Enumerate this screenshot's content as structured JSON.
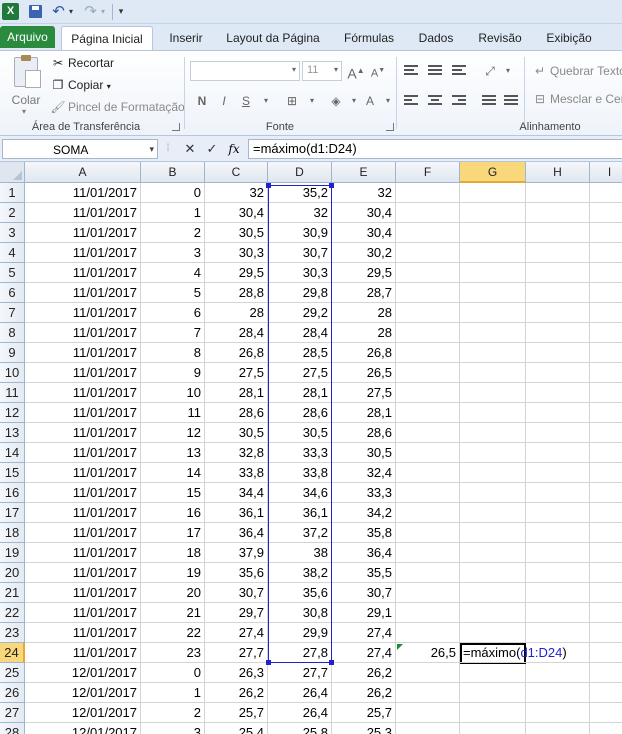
{
  "qat": {
    "undo": "↶",
    "redo": "↷",
    "excel": "X"
  },
  "tabs": [
    "Arquivo",
    "Página Inicial",
    "Inserir",
    "Layout da Página",
    "Fórmulas",
    "Dados",
    "Revisão",
    "Exibição"
  ],
  "ribbon": {
    "clipboard": {
      "paste": "Colar",
      "cut": "Recortar",
      "copy": "Copiar",
      "painter": "Pincel de Formatação",
      "label": "Área de Transferência"
    },
    "font": {
      "name": "",
      "size": "11",
      "bold": "N",
      "italic": "I",
      "underline": "S",
      "label": "Fonte"
    },
    "alignment": {
      "wrap": "Quebrar Texto",
      "merge": "Mesclar e Cen",
      "label": "Alinhamento"
    }
  },
  "formula_bar": {
    "name_box": "SOMA",
    "formula": "=máximo(d1:D24)",
    "fx": "fx"
  },
  "columns": [
    "A",
    "B",
    "C",
    "D",
    "E",
    "F",
    "G",
    "H",
    "I"
  ],
  "rows": [
    [
      "1",
      "11/01/2017",
      "0",
      "32",
      "35,2",
      "32"
    ],
    [
      "2",
      "11/01/2017",
      "1",
      "30,4",
      "32",
      "30,4"
    ],
    [
      "3",
      "11/01/2017",
      "2",
      "30,5",
      "30,9",
      "30,4"
    ],
    [
      "4",
      "11/01/2017",
      "3",
      "30,3",
      "30,7",
      "30,2"
    ],
    [
      "5",
      "11/01/2017",
      "4",
      "29,5",
      "30,3",
      "29,5"
    ],
    [
      "6",
      "11/01/2017",
      "5",
      "28,8",
      "29,8",
      "28,7"
    ],
    [
      "7",
      "11/01/2017",
      "6",
      "28",
      "29,2",
      "28"
    ],
    [
      "8",
      "11/01/2017",
      "7",
      "28,4",
      "28,4",
      "28"
    ],
    [
      "9",
      "11/01/2017",
      "8",
      "26,8",
      "28,5",
      "26,8"
    ],
    [
      "10",
      "11/01/2017",
      "9",
      "27,5",
      "27,5",
      "26,5"
    ],
    [
      "11",
      "11/01/2017",
      "10",
      "28,1",
      "28,1",
      "27,5"
    ],
    [
      "12",
      "11/01/2017",
      "11",
      "28,6",
      "28,6",
      "28,1"
    ],
    [
      "13",
      "11/01/2017",
      "12",
      "30,5",
      "30,5",
      "28,6"
    ],
    [
      "14",
      "11/01/2017",
      "13",
      "32,8",
      "33,3",
      "30,5"
    ],
    [
      "15",
      "11/01/2017",
      "14",
      "33,8",
      "33,8",
      "32,4"
    ],
    [
      "16",
      "11/01/2017",
      "15",
      "34,4",
      "34,6",
      "33,3"
    ],
    [
      "17",
      "11/01/2017",
      "16",
      "36,1",
      "36,1",
      "34,2"
    ],
    [
      "18",
      "11/01/2017",
      "17",
      "36,4",
      "37,2",
      "35,8"
    ],
    [
      "19",
      "11/01/2017",
      "18",
      "37,9",
      "38",
      "36,4"
    ],
    [
      "20",
      "11/01/2017",
      "19",
      "35,6",
      "38,2",
      "35,5"
    ],
    [
      "21",
      "11/01/2017",
      "20",
      "30,7",
      "35,6",
      "30,7"
    ],
    [
      "22",
      "11/01/2017",
      "21",
      "29,7",
      "30,8",
      "29,1"
    ],
    [
      "23",
      "11/01/2017",
      "22",
      "27,4",
      "29,9",
      "27,4"
    ],
    [
      "24",
      "11/01/2017",
      "23",
      "27,7",
      "27,8",
      "27,4"
    ],
    [
      "25",
      "12/01/2017",
      "0",
      "26,3",
      "27,7",
      "26,2"
    ],
    [
      "26",
      "12/01/2017",
      "1",
      "26,2",
      "26,4",
      "26,2"
    ],
    [
      "27",
      "12/01/2017",
      "2",
      "25,7",
      "26,4",
      "25,7"
    ],
    [
      "28",
      "12/01/2017",
      "3",
      "25,4",
      "25,8",
      "25,3"
    ]
  ],
  "cell_f24": "26,5",
  "edit_cell": {
    "prefix": "=máximo(",
    "ref": "d1:D24",
    "suffix": ")"
  }
}
